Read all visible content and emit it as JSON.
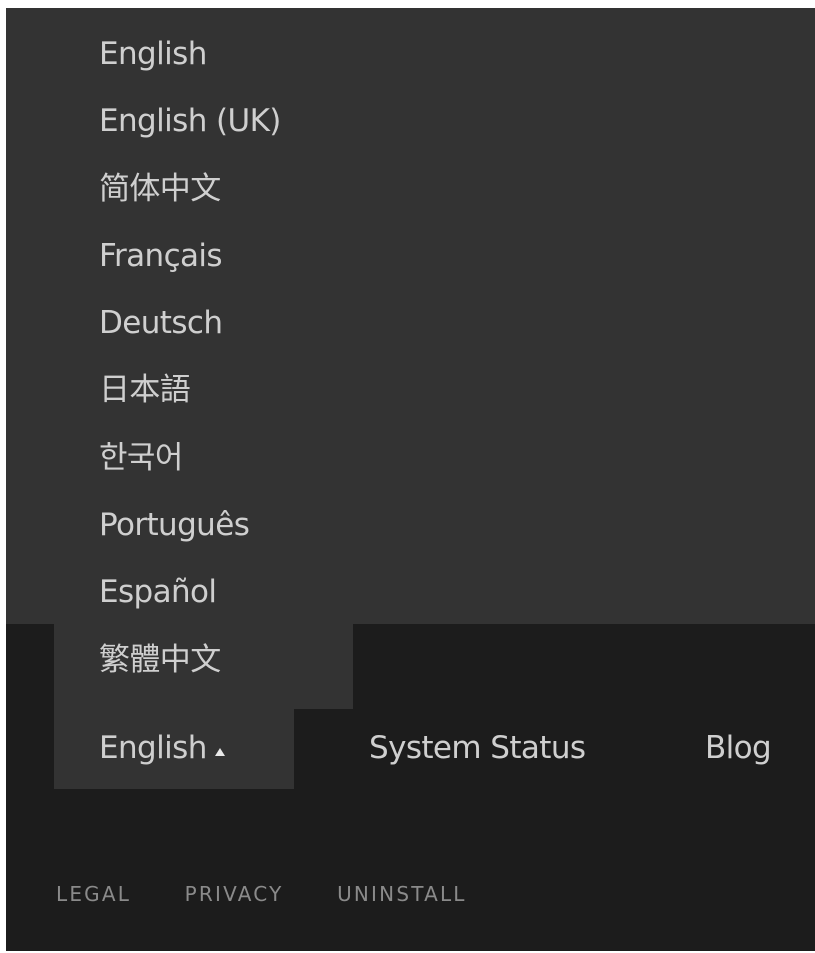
{
  "language_menu": {
    "options": [
      {
        "label": "English"
      },
      {
        "label": "English (UK)"
      },
      {
        "label": "简体中文"
      },
      {
        "label": "Français"
      },
      {
        "label": "Deutsch"
      },
      {
        "label": "日本語"
      },
      {
        "label": "한국어"
      },
      {
        "label": "Português"
      },
      {
        "label": "Español"
      },
      {
        "label": "繁體中文"
      }
    ],
    "selected_label": "English",
    "expanded_indicator": "caret-up-icon"
  },
  "footer_nav": {
    "system_status": "System Status",
    "blog": "Blog"
  },
  "legal_links": {
    "legal": "LEGAL",
    "privacy": "PRIVACY",
    "uninstall": "UNINSTALL"
  },
  "colors": {
    "footer_bg": "#1c1c1c",
    "menu_bg": "#333333",
    "text": "#cfcfcf",
    "muted_text": "#8a8a8a"
  }
}
